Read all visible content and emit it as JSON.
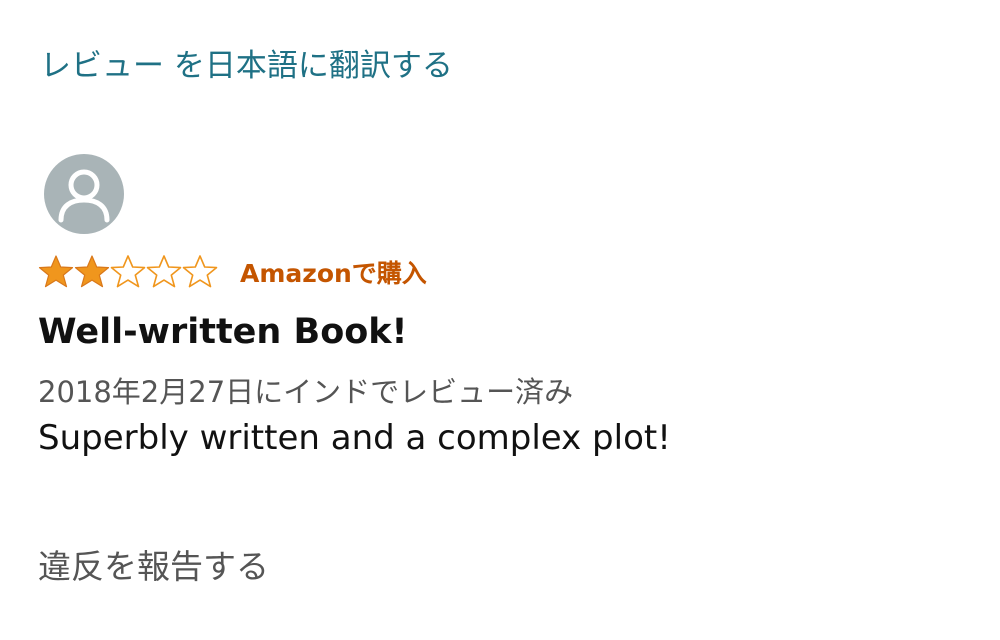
{
  "translate_link": "レビュー を日本語に翻訳する",
  "reviewer": {
    "name": "",
    "avatar_icon": "user-silhouette-icon"
  },
  "rating": {
    "value": 2,
    "max": 5,
    "filled_color": "#f0961d",
    "empty_color": "#f0961d"
  },
  "purchase_badge": "Amazonで購入",
  "review": {
    "title": "Well-written Book!",
    "date": "2018年2月27日にインドでレビュー済み",
    "body": "Superbly written and a complex plot!"
  },
  "report_link": "違反を報告する",
  "colors": {
    "link": "#1f7185",
    "badge": "#c45500",
    "secondary_text": "#555555",
    "avatar_bg": "#a9b4b7"
  }
}
